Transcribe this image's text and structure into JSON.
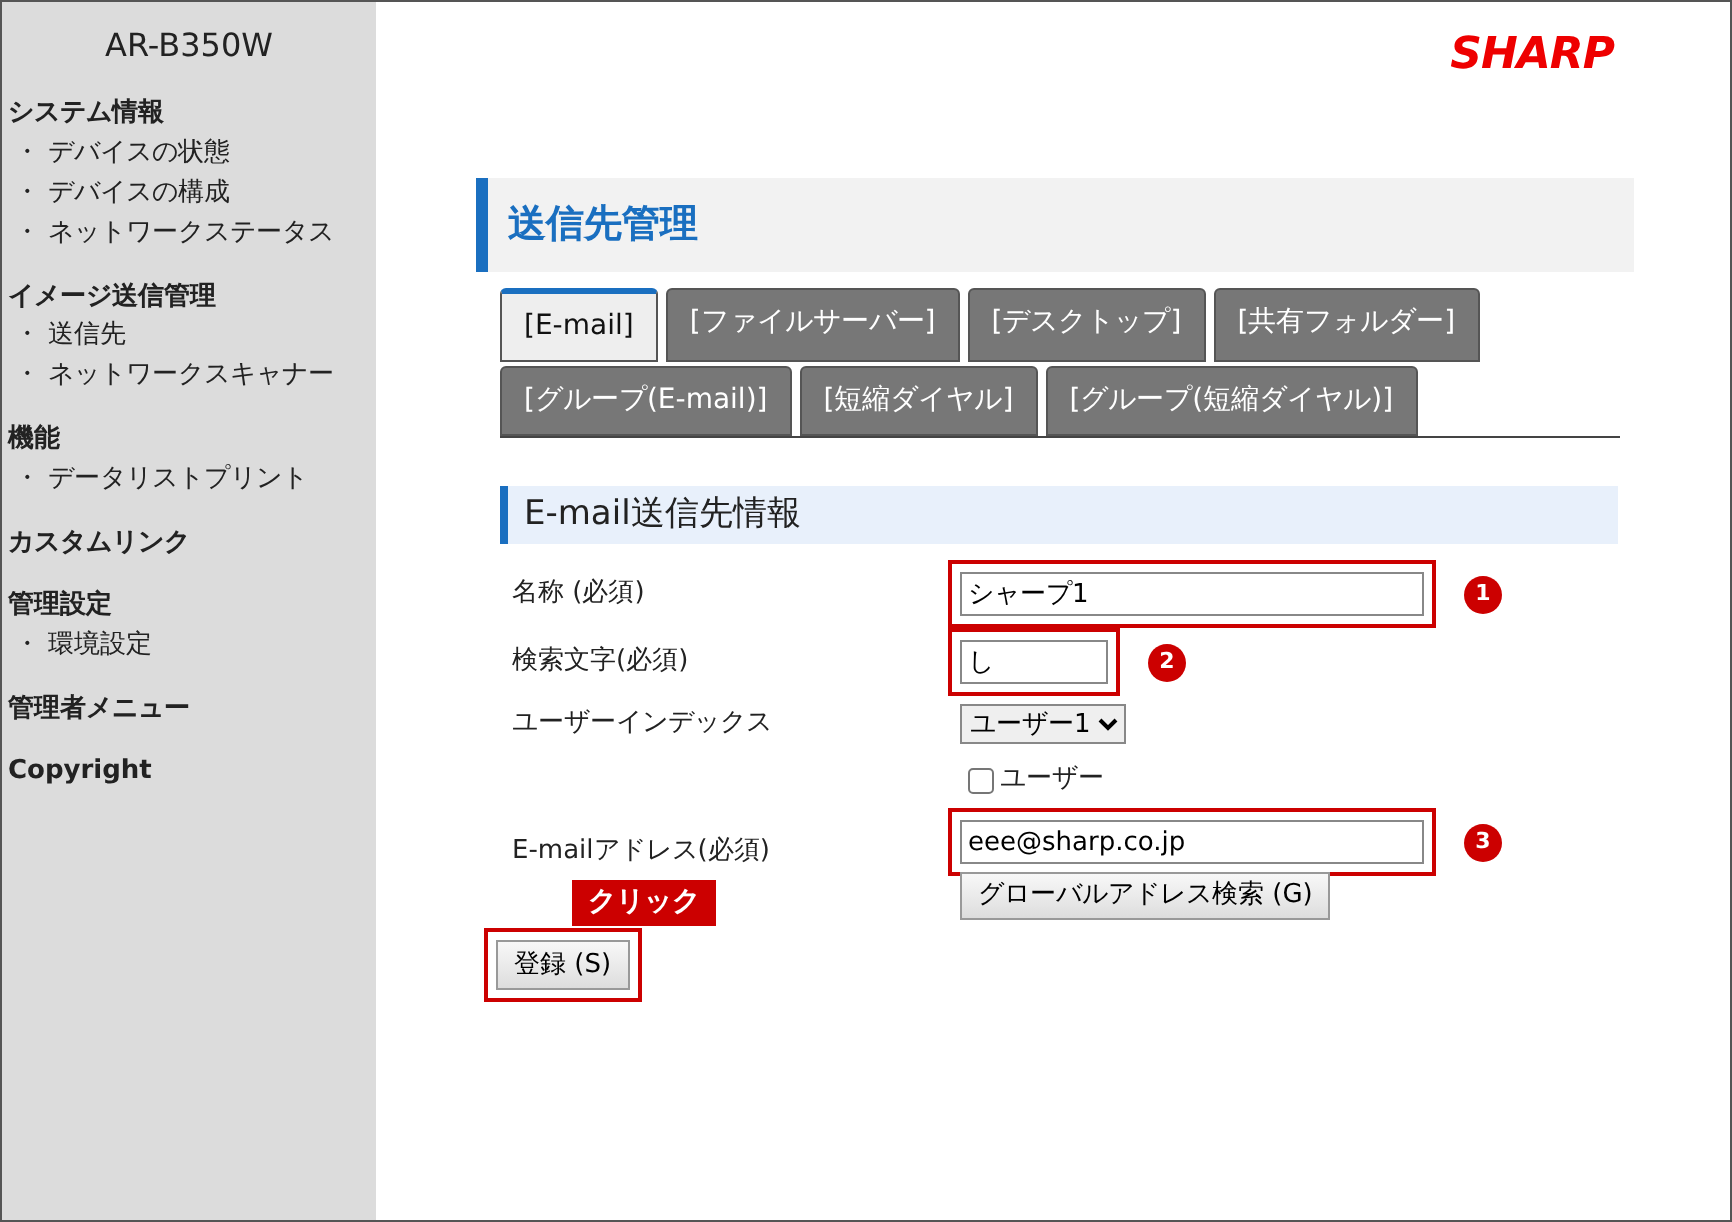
{
  "sidebar": {
    "model": "AR-B350W",
    "sections": [
      {
        "title": "システム情報",
        "items": [
          "・ デバイスの状態",
          "・ デバイスの構成",
          "・ ネットワークステータス"
        ]
      },
      {
        "title": "イメージ送信管理",
        "items": [
          "・ 送信先",
          "・ ネットワークスキャナー"
        ]
      },
      {
        "title": "機能",
        "items": [
          "・ データリストプリント"
        ]
      },
      {
        "title": "カスタムリンク"
      },
      {
        "title": "管理設定",
        "items": [
          "・ 環境設定"
        ]
      },
      {
        "title": "管理者メニュー"
      },
      {
        "title": "Copyright"
      }
    ]
  },
  "logo": "SHARP",
  "page_title": "送信先管理",
  "tabs": [
    {
      "label": "[E-mail]",
      "selected": true
    },
    {
      "label": "[ファイルサーバー]",
      "selected": false
    },
    {
      "label": "[デスクトップ]",
      "selected": false
    },
    {
      "label": "[共有フォルダー]",
      "selected": false
    },
    {
      "label": "[グループ(E-mail)]",
      "selected": false
    },
    {
      "label": "[短縮ダイヤル]",
      "selected": false
    },
    {
      "label": "[グループ(短縮ダイヤル)]",
      "selected": false
    }
  ],
  "section_title": "E-mail送信先情報",
  "fields": [
    {
      "kind": "text",
      "label": "名称 (必須)",
      "value": "シャープ1",
      "step": "1"
    },
    {
      "kind": "short",
      "label": "検索文字(必須)",
      "value": "し",
      "step": "2"
    },
    {
      "kind": "select",
      "label": "ユーザーインデックス",
      "value": "ユーザー1"
    },
    {
      "kind": "checkbox",
      "label": "ユーザー",
      "checked": false
    },
    {
      "kind": "email",
      "label": "E-mailアドレス(必須)",
      "value": "eee@sharp.co.jp",
      "step": "3",
      "button": "グローバルアドレス検索 (G)"
    }
  ],
  "submit": "登録 (S)",
  "callout": "クリック"
}
